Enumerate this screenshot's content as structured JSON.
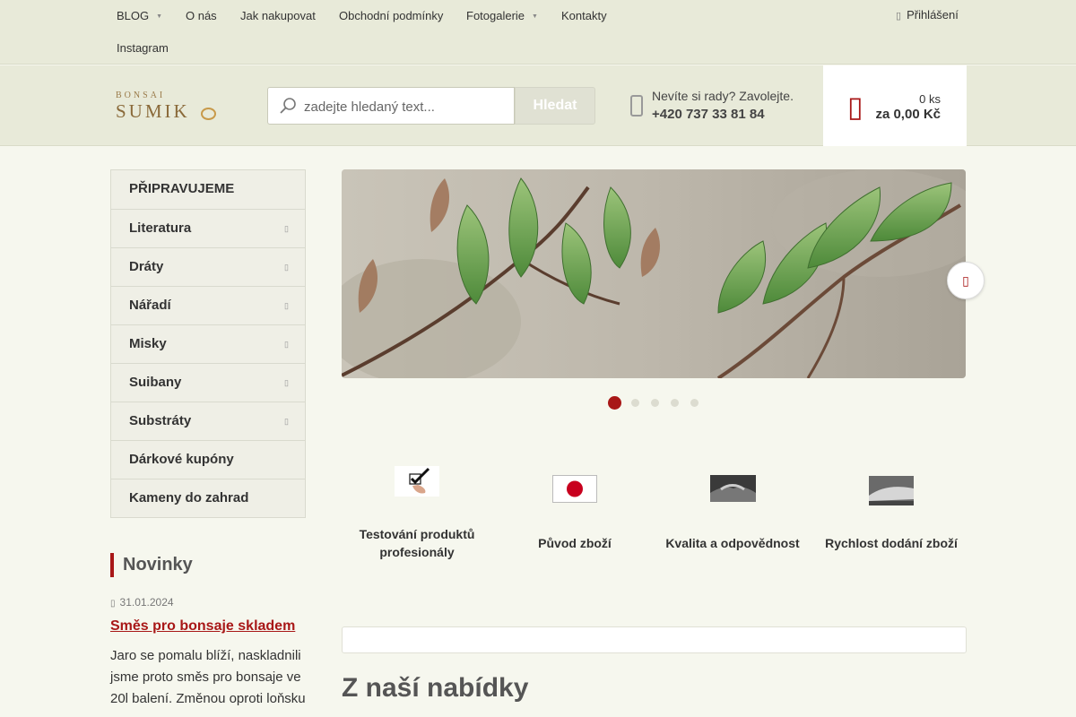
{
  "topnav": {
    "items": [
      {
        "label": "BLOG",
        "dropdown": true
      },
      {
        "label": "O nás",
        "dropdown": false
      },
      {
        "label": "Jak nakupovat",
        "dropdown": false
      },
      {
        "label": "Obchodní podmínky",
        "dropdown": false
      },
      {
        "label": "Fotogalerie",
        "dropdown": true
      },
      {
        "label": "Kontakty",
        "dropdown": false
      },
      {
        "label": "Instagram",
        "dropdown": false
      }
    ],
    "login_label": "Přihlášení"
  },
  "logo": {
    "small": "BONSAI",
    "big": "SUMIK"
  },
  "search": {
    "placeholder": "zadejte hledaný text...",
    "button_label": "Hledat"
  },
  "phone": {
    "prompt": "Nevíte si rady? Zavolejte.",
    "number": "+420 737 33 81 84"
  },
  "cart": {
    "count": "0 ks",
    "price": "za 0,00 Kč",
    "accent": "#a81717"
  },
  "sidebar": {
    "items": [
      {
        "label": "PŘIPRAVUJEME",
        "has_submenu": false
      },
      {
        "label": "Literatura",
        "has_submenu": true
      },
      {
        "label": "Dráty",
        "has_submenu": true
      },
      {
        "label": "Nářadí",
        "has_submenu": true
      },
      {
        "label": "Misky",
        "has_submenu": true
      },
      {
        "label": "Suibany",
        "has_submenu": true
      },
      {
        "label": "Substráty",
        "has_submenu": true
      },
      {
        "label": "Dárkové kupóny",
        "has_submenu": false
      },
      {
        "label": "Kameny do zahrad",
        "has_submenu": false
      }
    ]
  },
  "news": {
    "title": "Novinky",
    "date": "31.01.2024",
    "headline": "Směs pro bonsaje skladem",
    "text": "Jaro se pomalu blíží, naskladnili jsme proto směs pro bonsaje ve 20l balení. Změnou oproti loňsku"
  },
  "slider": {
    "slide_count": 5,
    "active_index": 0
  },
  "features": [
    {
      "label": "Testování produktů profesionály",
      "icon": "checkmark-hand-icon"
    },
    {
      "label": "Původ zboží",
      "icon": "japan-flag-icon"
    },
    {
      "label": "Kvalita a odpovědnost",
      "icon": "handshake-icon"
    },
    {
      "label": "Rychlost dodání zboží",
      "icon": "bullet-train-icon"
    }
  ],
  "offer": {
    "title": "Z naší nabídky"
  }
}
